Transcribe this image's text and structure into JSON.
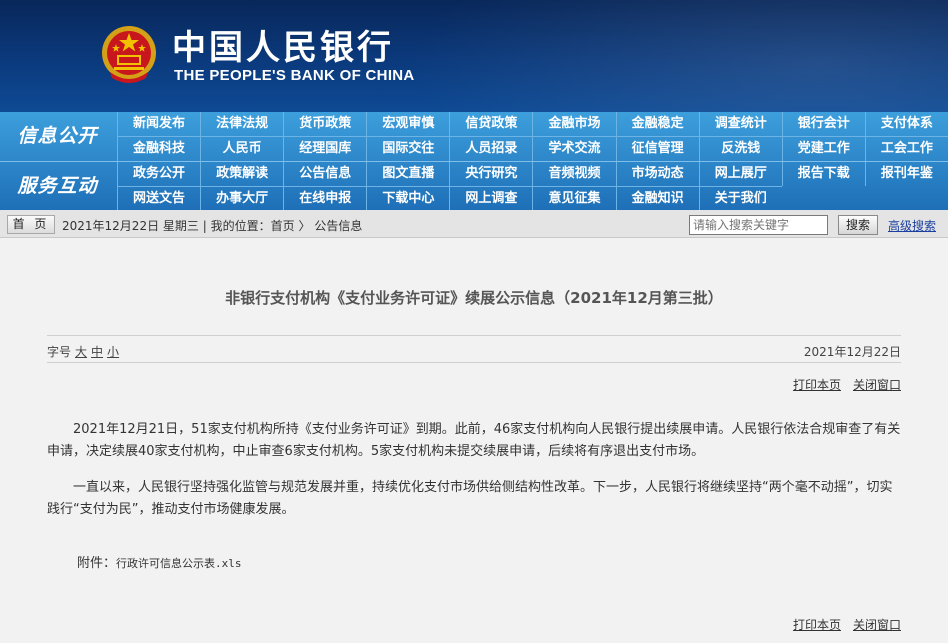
{
  "colors": {
    "banner_bg": "#0b3a7d",
    "nav_bg": "#2a86cc",
    "page_bg": "#f2f2f2"
  },
  "header": {
    "bank_name_cn": "中国人民银行",
    "bank_name_en": "THE PEOPLE'S BANK OF CHINA",
    "emblem_icon": "national-emblem-icon"
  },
  "nav": {
    "group1_title": "信息公开",
    "group1_items": [
      "新闻发布",
      "法律法规",
      "货币政策",
      "宏观审慎",
      "信贷政策",
      "金融市场",
      "金融稳定",
      "调查统计",
      "银行会计",
      "支付体系",
      "金融科技",
      "人民币",
      "经理国库",
      "国际交往",
      "人员招录",
      "学术交流",
      "征信管理",
      "反洗钱",
      "党建工作",
      "工会工作"
    ],
    "group2_title": "服务互动",
    "group2_items": [
      "政务公开",
      "政策解读",
      "公告信息",
      "图文直播",
      "央行研究",
      "音频视频",
      "市场动态",
      "网上展厅",
      "报告下载",
      "报刊年鉴",
      "网送文告",
      "办事大厅",
      "在线申报",
      "下载中心",
      "网上调查",
      "意见征集",
      "金融知识",
      "关于我们"
    ]
  },
  "breadcrumb": {
    "home_label": "首 页",
    "date": "2021年12月22日",
    "weekday": "星期三",
    "separator": "|",
    "location_label": "我的位置：",
    "home_link": "首页",
    "arrow": "〉",
    "current": "公告信息"
  },
  "search": {
    "placeholder": "请输入搜索关键字",
    "button": "搜索",
    "advanced": "高级搜索"
  },
  "article": {
    "title": "非银行支付机构《支付业务许可证》续展公示信息（2021年12月第三批）",
    "fontsize_label": "字号",
    "font_large": "大",
    "font_medium": "中",
    "font_small": "小",
    "date": "2021年12月22日",
    "print": "打印本页",
    "close": "关闭窗口",
    "paragraph1": "2021年12月21日，51家支付机构所持《支付业务许可证》到期。此前，46家支付机构向人民银行提出续展申请。人民银行依法合规审查了有关申请，决定续展40家支付机构，中止审查6家支付机构。5家支付机构未提交续展申请，后续将有序退出支付市场。",
    "paragraph2": "一直以来，人民银行坚持强化监管与规范发展并重，持续优化支付市场供给侧结构性改革。下一步，人民银行将继续坚持“两个毫不动摇”，切实践行“支付为民”，推动支付市场健康发展。",
    "attachment_label": "附件：",
    "attachment_file": "行政许可信息公示表.xls"
  }
}
